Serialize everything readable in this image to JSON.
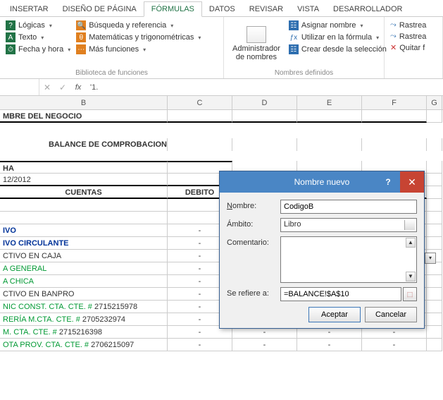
{
  "tabs": [
    "INSERTAR",
    "DISEÑO DE PÁGINA",
    "FÓRMULAS",
    "DATOS",
    "REVISAR",
    "VISTA",
    "DESARROLLADOR"
  ],
  "active_tab_index": 2,
  "ribbon": {
    "lib_group": "Biblioteca de funciones",
    "names_group": "Nombres definidos",
    "logicas": "Lógicas",
    "texto": "Texto",
    "fechahora": "Fecha y hora",
    "busqueda": "Búsqueda y referencia",
    "mattrig": "Matemáticas y trigonométricas",
    "masfunc": "Más funciones",
    "admin1": "Administrador",
    "admin2": "de nombres",
    "asignar": "Asignar nombre",
    "utilizar": "Utilizar en la fórmula",
    "crear": "Crear desde la selección",
    "rastrea1": "Rastrea",
    "rastrea2": "Rastrea",
    "quitar": "Quitar f"
  },
  "formula_bar": {
    "value": "'1."
  },
  "columns": [
    "B",
    "C",
    "D",
    "E",
    "F",
    "G"
  ],
  "sheet": {
    "negocio": "MBRE DEL NEGOCIO",
    "balance": "BALANCE DE COMPROBACION",
    "ha": "HA",
    "fecha": "12/2012",
    "cuentas": "CUENTAS",
    "debito": "DEBITO",
    "r_ivo": "IVO",
    "r_ivocirc": "IVO CIRCULANTE",
    "r_caja": "CTIVO EN CAJA",
    "r_gen": "A GENERAL",
    "r_chica": "A CHICA",
    "r_banpro": "CTIVO EN BANPRO",
    "r_nic": "NIC CONST. CTA. CTE. #",
    "r_nic_num": "2715215978",
    "r_reria": "RERÍA M.CTA. CTE. #",
    "r_reria_num": "2705232974",
    "r_mcta": "M. CTA. CTE. #",
    "r_mcta_num": "2715216398",
    "r_ota": "OTA PROV. CTA. CTE. #",
    "r_ota_num": "2706215097",
    "dash": "-"
  },
  "dialog": {
    "title": "Nombre nuevo",
    "nombre_lbl": "Nombre:",
    "nombre_val": "CodigoB",
    "ambito_lbl": "Ámbito:",
    "ambito_val": "Libro",
    "comentario_lbl": "Comentario:",
    "refiere_lbl": "Se refiere a:",
    "refiere_val": "=BALANCE!$A$10",
    "aceptar": "Aceptar",
    "cancelar": "Cancelar"
  }
}
